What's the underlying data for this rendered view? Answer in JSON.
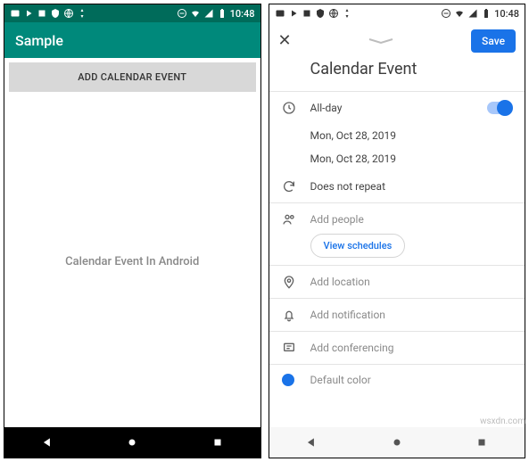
{
  "statusbar": {
    "time": "10:48"
  },
  "left": {
    "appbar_title": "Sample",
    "add_button": "ADD CALENDAR EVENT",
    "center_text": "Calendar Event In Android"
  },
  "right": {
    "save": "Save",
    "title": "Calendar Event",
    "allday": "All-day",
    "start_date": "Mon, Oct 28, 2019",
    "end_date": "Mon, Oct 28, 2019",
    "repeat": "Does not repeat",
    "add_people": "Add people",
    "view_schedules": "View schedules",
    "add_location": "Add location",
    "add_notification": "Add notification",
    "add_conferencing": "Add conferencing",
    "default_color": "Default color"
  },
  "watermark": "wsxdn.com"
}
